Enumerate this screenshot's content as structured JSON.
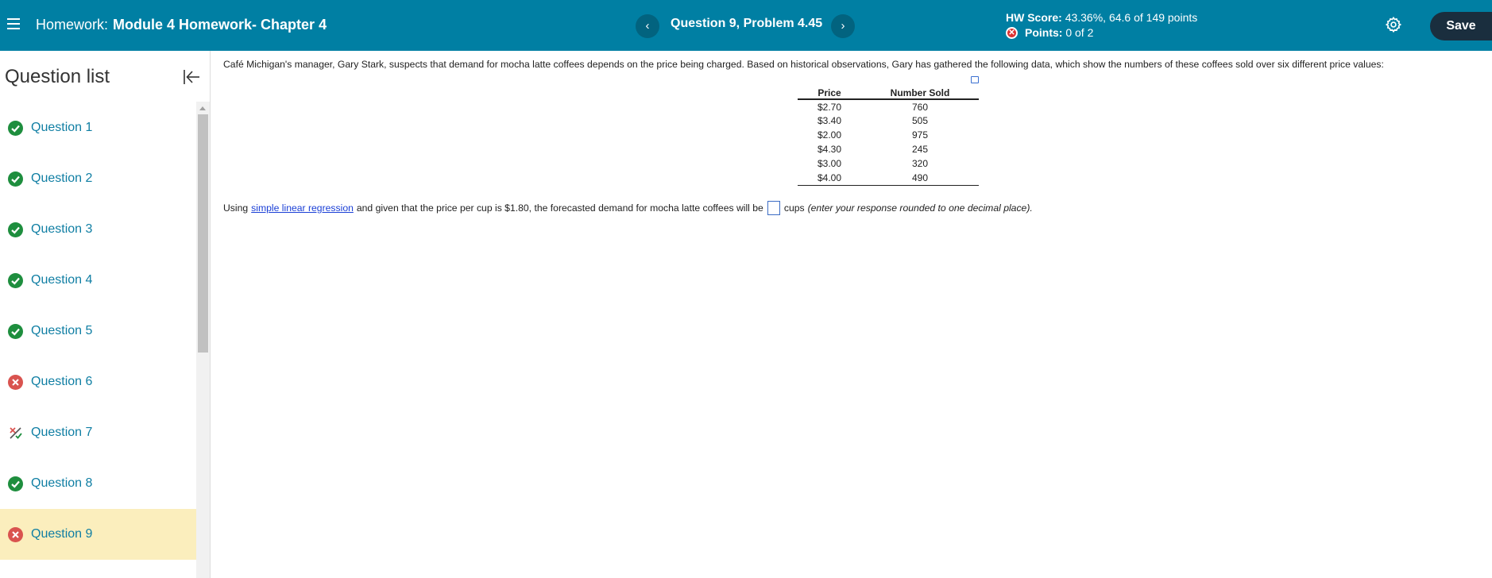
{
  "header": {
    "homework_label": "Homework:",
    "homework_name": "Module 4 Homework- Chapter 4",
    "question_title": "Question 9, Problem 4.45",
    "prev_symbol": "‹",
    "next_symbol": "›",
    "hw_score_label": "HW Score:",
    "hw_score_value": "43.36%, 64.6 of 149 points",
    "points_label": "Points:",
    "points_value": "0 of 2",
    "save_label": "Save",
    "bar_color": "#007fa3"
  },
  "sidebar": {
    "title": "Question list",
    "items": [
      {
        "label": "Question 1",
        "status": "correct"
      },
      {
        "label": "Question 2",
        "status": "correct"
      },
      {
        "label": "Question 3",
        "status": "correct"
      },
      {
        "label": "Question 4",
        "status": "correct"
      },
      {
        "label": "Question 5",
        "status": "correct"
      },
      {
        "label": "Question 6",
        "status": "wrong"
      },
      {
        "label": "Question 7",
        "status": "partial"
      },
      {
        "label": "Question 8",
        "status": "correct"
      },
      {
        "label": "Question 9",
        "status": "wrong",
        "active": true
      }
    ]
  },
  "content": {
    "intro": "Café Michigan's manager, Gary Stark, suspects that demand for mocha latte coffees depends on the price being charged.  Based on historical observations, Gary has gathered the following data, which show the numbers of these coffees sold over six different price values:",
    "table": {
      "headers": [
        "Price",
        "Number Sold"
      ],
      "rows": [
        [
          "$2.70",
          "760"
        ],
        [
          "$3.40",
          "505"
        ],
        [
          "$2.00",
          "975"
        ],
        [
          "$4.30",
          "245"
        ],
        [
          "$3.00",
          "320"
        ],
        [
          "$4.00",
          "490"
        ]
      ]
    },
    "question_before": "Using",
    "question_link": "simple linear regression",
    "question_middle": "and given that the price per cup is $1.80, the forecasted demand for mocha latte coffees will be",
    "answer_value": "",
    "question_unit": "cups",
    "question_hint": "(enter your response rounded to one decimal place)."
  }
}
